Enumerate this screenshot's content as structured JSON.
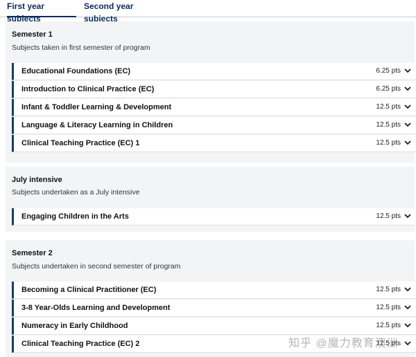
{
  "tabs": [
    {
      "label": "First year subjects",
      "active": true
    },
    {
      "label": "Second year subjects",
      "active": false
    }
  ],
  "sections": [
    {
      "title": "Semester 1",
      "description": "Subjects taken in first semester of program",
      "subjects": [
        {
          "name": "Educational Foundations (EC)",
          "points": "6.25 pts"
        },
        {
          "name": "Introduction to Clinical Practice (EC)",
          "points": "6.25 pts"
        },
        {
          "name": "Infant & Toddler Learning & Development",
          "points": "12.5 pts"
        },
        {
          "name": "Language & Literacy Learning in Children",
          "points": "12.5 pts"
        },
        {
          "name": "Clinical Teaching Practice (EC) 1",
          "points": "12.5 pts"
        }
      ]
    },
    {
      "title": "July intensive",
      "description": "Subjects undertaken as a July intensive",
      "subjects": [
        {
          "name": "Engaging Children in the Arts",
          "points": "12.5 pts"
        }
      ]
    },
    {
      "title": "Semester 2",
      "description": "Subjects undertaken in second semester of program",
      "subjects": [
        {
          "name": "Becoming a Clinical Practitioner (EC)",
          "points": "12.5 pts"
        },
        {
          "name": "3-8 Year-Olds Learning and Development",
          "points": "12.5 pts"
        },
        {
          "name": "Numeracy in Early Childhood",
          "points": "12.5 pts"
        },
        {
          "name": "Clinical Teaching Practice (EC) 2",
          "points": "12.5 pts"
        }
      ]
    }
  ],
  "icons": {
    "expand": "chevron-down-icon"
  },
  "colors": {
    "accent": "#1b3a6b",
    "tab_text": "#0a2a5e",
    "section_bg": "#f3f4f6"
  },
  "watermark": "知乎 @魔力教育澳洲"
}
